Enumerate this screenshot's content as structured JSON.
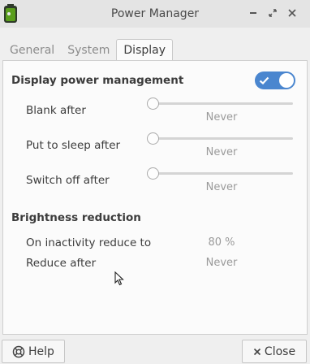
{
  "window": {
    "title": "Power Manager"
  },
  "tabs": [
    {
      "label": "General"
    },
    {
      "label": "System"
    },
    {
      "label": "Display"
    }
  ],
  "display_power": {
    "title": "Display power management",
    "enabled": true,
    "rows": [
      {
        "label": "Blank after",
        "value": "Never"
      },
      {
        "label": "Put to sleep after",
        "value": "Never"
      },
      {
        "label": "Switch off after",
        "value": "Never"
      }
    ]
  },
  "brightness": {
    "title": "Brightness reduction",
    "rows": [
      {
        "label": "On inactivity reduce to",
        "value": "80 %"
      },
      {
        "label": "Reduce after",
        "value": "Never"
      }
    ]
  },
  "buttons": {
    "help": "Help",
    "close": "Close"
  },
  "colors": {
    "accent": "#4a86cf",
    "app_icon": "#5a9e1c"
  },
  "icons": {
    "app": "battery-icon",
    "minimize": "minimize-icon",
    "restore": "restore-icon",
    "close": "close-icon",
    "help": "lifebuoy-icon",
    "close_button": "x-icon",
    "toggle_check": "check-icon"
  }
}
